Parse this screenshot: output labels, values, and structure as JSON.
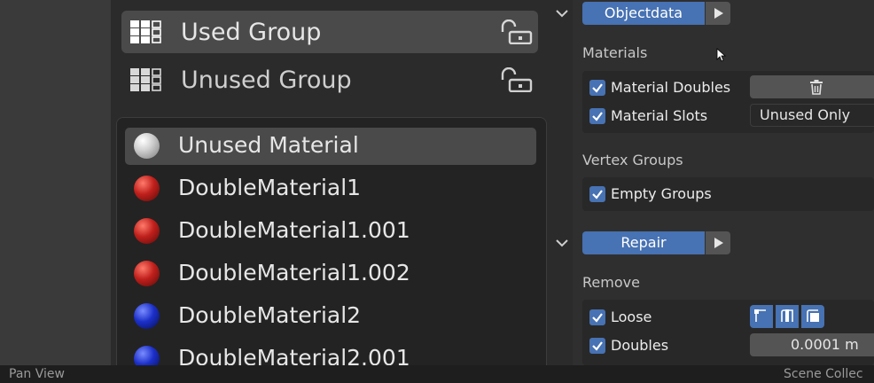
{
  "groups": [
    {
      "label": "Used Group",
      "active": true
    },
    {
      "label": "Unused Group",
      "active": false
    }
  ],
  "materials": [
    {
      "label": "Unused Material",
      "color": "#d0d0d0",
      "active": true
    },
    {
      "label": "DoubleMaterial1",
      "color": "#c0201c",
      "active": false
    },
    {
      "label": "DoubleMaterial1.001",
      "color": "#c0201c",
      "active": false
    },
    {
      "label": "DoubleMaterial1.002",
      "color": "#c0201c",
      "active": false
    },
    {
      "label": "DoubleMaterial2",
      "color": "#1b2fc9",
      "active": false
    },
    {
      "label": "DoubleMaterial2.001",
      "color": "#1b2fc9",
      "active": false
    }
  ],
  "objectdata": {
    "button": "Objectdata",
    "materials_heading": "Materials",
    "material_doubles": "Material Doubles",
    "material_slots": "Material Slots",
    "material_slots_value": "Unused Only",
    "vertex_groups_heading": "Vertex Groups",
    "empty_groups": "Empty Groups"
  },
  "repair": {
    "button": "Repair",
    "remove_heading": "Remove",
    "loose": "Loose",
    "doubles": "Doubles",
    "doubles_value": "0.0001 m"
  },
  "statusbar": {
    "left": "Pan View",
    "right": "Scene Collec"
  },
  "colors": {
    "accent": "#4772b3",
    "panel": "#2b2b2b",
    "highlight": "#4a4a4a"
  }
}
